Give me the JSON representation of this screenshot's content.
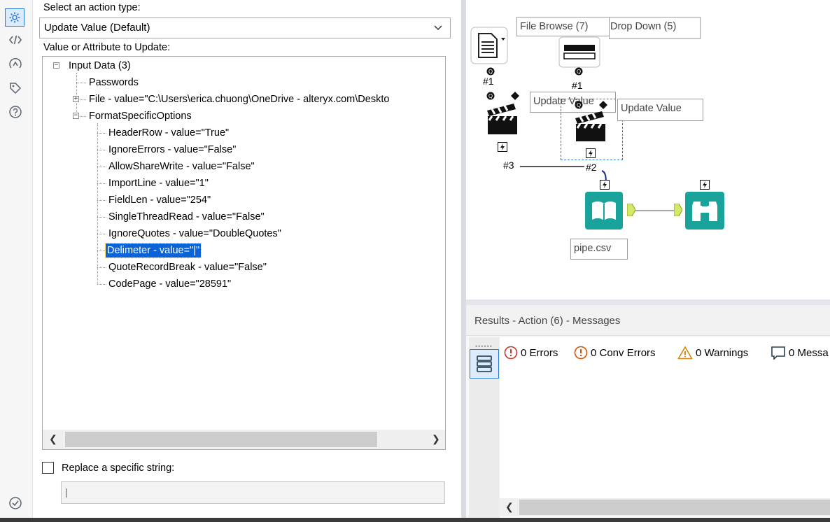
{
  "sidebar": {
    "icons": [
      {
        "name": "configuration-gear-icon",
        "active": true
      },
      {
        "name": "xml-code-icon",
        "active": false
      },
      {
        "name": "annotation-icon",
        "active": false
      },
      {
        "name": "tag-icon",
        "active": false
      },
      {
        "name": "help-icon",
        "active": false
      }
    ],
    "bottom_icon": "check-circle-icon"
  },
  "config": {
    "action_type_label": "Select an action type:",
    "action_type_value": "Update Value (Default)",
    "value_attr_label": "Value or Attribute to Update:",
    "tree": {
      "root": "Input Data (3)",
      "root_children": [
        "Passwords",
        "File - value=\"C:\\Users\\erica.chuong\\OneDrive - alteryx.com\\Deskto",
        "FormatSpecificOptions"
      ],
      "format_options": [
        "HeaderRow - value=\"True\"",
        "IgnoreErrors - value=\"False\"",
        "AllowShareWrite - value=\"False\"",
        "ImportLine - value=\"1\"",
        "FieldLen - value=\"254\"",
        "SingleThreadRead - value=\"False\"",
        "IgnoreQuotes - value=\"DoubleQuotes\"",
        "Delimeter - value=\"|\"",
        "QuoteRecordBreak - value=\"False\"",
        "CodePage - value=\"28591\""
      ],
      "selected": "Delimeter - value=\"|\""
    },
    "replace_label": "Replace a specific string:",
    "replace_checked": false,
    "replace_value": "|"
  },
  "canvas": {
    "labels": {
      "file_browse": "File Browse (7)",
      "drop_down": "Drop Down (5)",
      "update_value_1": "Update Value",
      "update_value_2": "Update Value",
      "pipe_csv": "pipe.csv"
    },
    "ids": {
      "file_browse_id": "#1",
      "drop_down_id": "#1",
      "action3_id": "#3",
      "action2_id": "#2"
    }
  },
  "results": {
    "title": "Results - Action (6) - Messages",
    "errors": "0 Errors",
    "conv_errors": "0 Conv Errors",
    "warnings": "0 Warnings",
    "messages": "0 Messa"
  },
  "colors": {
    "accent": "#2e7bd6",
    "selection": "#0a64d8",
    "teal": "#1aa39a",
    "error_red": "#c0392b",
    "warning_orange": "#d4880f"
  }
}
